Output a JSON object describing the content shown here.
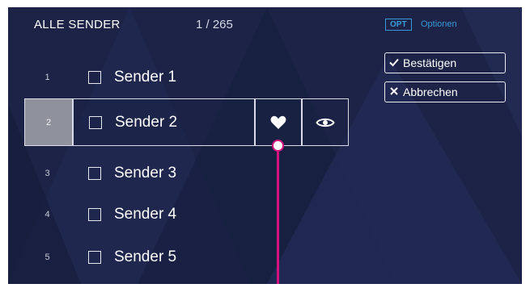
{
  "header": {
    "title": "ALLE SENDER",
    "count": "1 / 265"
  },
  "options_hint": {
    "key": "OPT",
    "label": "Optionen"
  },
  "actions": {
    "confirm_label": "Bestätigen",
    "confirm_icon": "checkmark-icon",
    "cancel_label": "Abbrechen",
    "cancel_icon": "x-icon"
  },
  "channels": [
    {
      "number": "1",
      "name": "Sender 1",
      "checked": false
    },
    {
      "number": "2",
      "name": "Sender 2",
      "checked": false,
      "selected": true
    },
    {
      "number": "3",
      "name": "Sender 3",
      "checked": false
    },
    {
      "number": "4",
      "name": "Sender 4",
      "checked": false
    },
    {
      "number": "5",
      "name": "Sender 5",
      "checked": false
    }
  ],
  "selected_row_icons": [
    "heart-icon",
    "eye-icon"
  ],
  "colors": {
    "background": "#1c2346",
    "accent_blue": "#3a9ad9",
    "callout_magenta": "#d4137f",
    "selected_number_bg": "#8f919c"
  }
}
